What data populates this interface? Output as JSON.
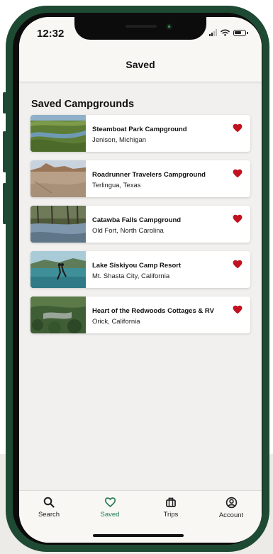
{
  "status_bar": {
    "time": "12:32"
  },
  "header": {
    "title": "Saved"
  },
  "section_title": "Saved Campgrounds",
  "campgrounds": [
    {
      "name": "Steamboat Park Campground",
      "location": "Jenison, Michigan",
      "saved": true
    },
    {
      "name": "Roadrunner Travelers Campground",
      "location": "Terlingua, Texas",
      "saved": true
    },
    {
      "name": "Catawba Falls Campground",
      "location": "Old Fort, North Carolina",
      "saved": true
    },
    {
      "name": "Lake Siskiyou Camp Resort",
      "location": "Mt. Shasta City, California",
      "saved": true
    },
    {
      "name": "Heart of the Redwoods Cottages & RV",
      "location": "Orick, California",
      "saved": true
    }
  ],
  "tab_bar": {
    "active": "Saved",
    "tabs": [
      {
        "label": "Search",
        "icon": "search-icon"
      },
      {
        "label": "Saved",
        "icon": "heart-outline-icon"
      },
      {
        "label": "Trips",
        "icon": "suitcase-icon"
      },
      {
        "label": "Account",
        "icon": "account-circle-icon"
      }
    ]
  },
  "colors": {
    "phone_frame": "#1e4a33",
    "accent_green": "#1f7a4d",
    "heart_red": "#c2121f",
    "screen_bg": "#f1f0ee"
  }
}
